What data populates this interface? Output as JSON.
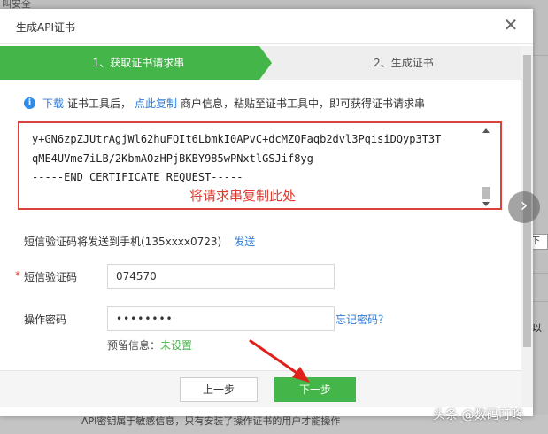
{
  "background": {
    "top_text": "叫安全",
    "right_label": "下一",
    "right_label2": "以舞",
    "bottom_text": "API密钥属于敏感信息，只有安装了操作证书的用户才能操作"
  },
  "modal": {
    "title": "生成API证书",
    "close_label": "✕",
    "steps": [
      {
        "label": "1、获取证书请求串",
        "active": true
      },
      {
        "label": "2、生成证书",
        "active": false
      }
    ],
    "info": {
      "download_link": "下载",
      "text1": "证书工具后，",
      "copy_link": "点此复制",
      "text2": "商户信息，粘贴至证书工具中，即可获得证书请求串"
    },
    "csr": {
      "lines": [
        "y+GN6zpZJUtrAgjWl62huFQIt6LbmkI0APvC+dcMZQFaqb2dvl3PqisiDQyp3T3T",
        "qME4UVme7iLB/2KbmAOzHPjBKBY985wPNxtlGSJif8yg",
        "-----END CERTIFICATE REQUEST-----"
      ],
      "annotation": "将请求串复制此处"
    },
    "sms": {
      "text": "短信验证码将发送到手机(135xxxx0723)",
      "send_link": "发送"
    },
    "form": {
      "required_mark": "*",
      "sms_code_label": "短信验证码",
      "sms_code_value": "074570",
      "password_label": "操作密码",
      "password_value": "••••••••",
      "forgot_link": "忘记密码？",
      "reserve_label": "预留信息：",
      "reserve_value": "未设置"
    },
    "buttons": {
      "prev": "上一步",
      "next": "下一步"
    }
  },
  "carousel_icon": "chevron-right-icon",
  "watermark": "头条 @数码叮咚",
  "colors": {
    "primary_green": "#44b549",
    "link_blue": "#2d7bd8",
    "highlight_red": "#d9413c"
  }
}
